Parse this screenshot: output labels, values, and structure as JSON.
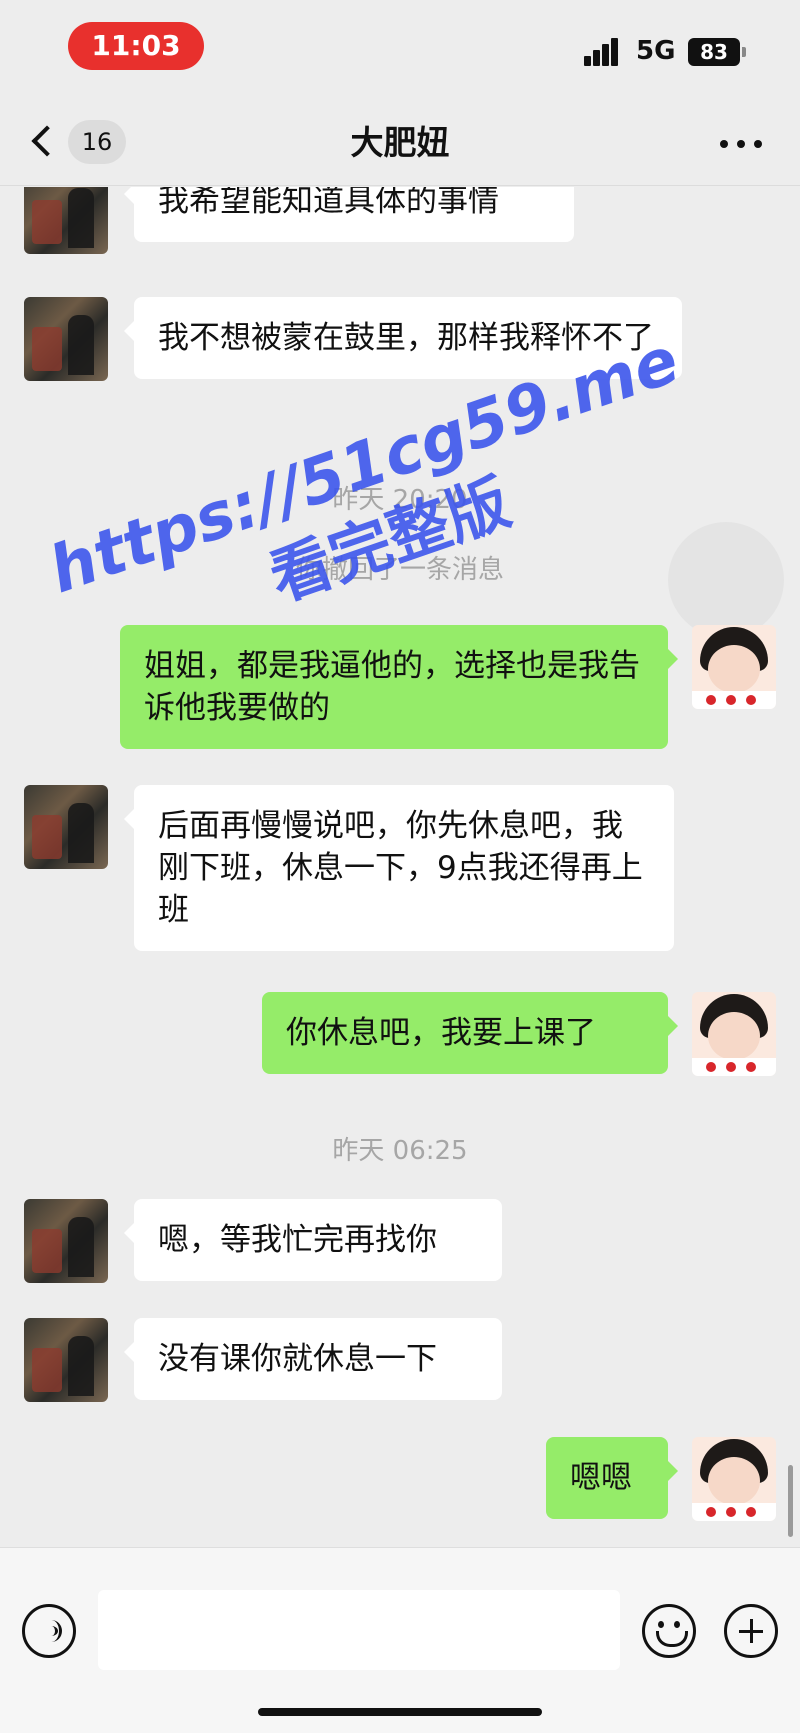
{
  "status_bar": {
    "time": "11:03",
    "network": "5G",
    "battery": "83"
  },
  "nav": {
    "unread_count": "16",
    "title": "大肥妞"
  },
  "messages": [
    {
      "from": "contact",
      "text": "我希望能知道具体的事情"
    },
    {
      "from": "contact",
      "text": "我不想被蒙在鼓里，那样我释怀不了"
    },
    {
      "from": "system",
      "text": "昨天 20:20"
    },
    {
      "from": "system",
      "text": "你撤回了一条消息"
    },
    {
      "from": "self",
      "text": "姐姐，都是我逼他的，选择也是我告诉他我要做的"
    },
    {
      "from": "contact",
      "text": "后面再慢慢说吧，你先休息吧，我刚下班，休息一下，9点我还得再上班"
    },
    {
      "from": "self",
      "text": "你休息吧，我要上课了"
    },
    {
      "from": "system",
      "text": "昨天 06:25"
    },
    {
      "from": "contact",
      "text": "嗯，等我忙完再找你"
    },
    {
      "from": "contact",
      "text": "没有课你就休息一下"
    },
    {
      "from": "self",
      "text": "嗯嗯"
    }
  ],
  "watermark": {
    "url": "https://51cg59.me",
    "subtitle": "看完整版"
  },
  "input": {
    "value": "",
    "placeholder": ""
  },
  "icons": {
    "back": "chevron-left-icon",
    "more": "more-dots-icon",
    "voice": "voice-icon",
    "emoji": "emoji-icon",
    "plus": "plus-icon"
  },
  "colors": {
    "status_time_pill": "#e8302d",
    "outgoing_bubble": "#95ec69",
    "incoming_bubble": "#ffffff",
    "background": "#ededed",
    "watermark": "#3c55eb"
  }
}
